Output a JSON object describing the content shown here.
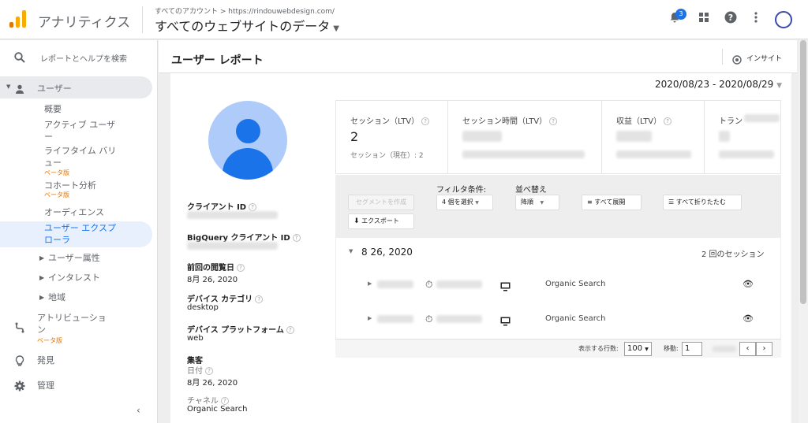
{
  "header": {
    "app_title": "アナリティクス",
    "breadcrumb": "すべてのアカウント > https://rindouwebdesign.com/",
    "property": "すべてのウェブサイトのデータ",
    "notification_count": "3"
  },
  "sidebar": {
    "search": "レポートとヘルプを検索",
    "users": "ユーザー",
    "items": [
      {
        "label": "概要"
      },
      {
        "label": "アクティブ ユーザー"
      },
      {
        "label": "ライフタイム バリュー",
        "beta": "ベータ版"
      },
      {
        "label": "コホート分析",
        "beta": "ベータ版"
      },
      {
        "label": "オーディエンス"
      },
      {
        "label": "ユーザー エクスプローラ"
      },
      {
        "label": "ユーザー属性"
      },
      {
        "label": "インタレスト"
      },
      {
        "label": "地域"
      }
    ],
    "attribution": "アトリビューション",
    "attribution_beta": "ベータ版",
    "discover": "発見",
    "admin": "管理"
  },
  "report": {
    "title": "ユーザー レポート",
    "insight": "インサイト",
    "date_range": "2020/08/23 - 2020/08/29"
  },
  "profile": {
    "client_id_label": "クライアント ID",
    "bigquery_label": "BigQuery クライアント ID",
    "last_seen_label": "前回の閲覧日",
    "last_seen": "8月 26, 2020",
    "device_category_label": "デバイス カテゴリ",
    "device_category": "desktop",
    "device_platform_label": "デバイス プラットフォーム",
    "device_platform": "web",
    "acquisition_label": "集客",
    "date_label": "日付",
    "date": "8月 26, 2020",
    "channel_label": "チャネル",
    "channel": "Organic Search"
  },
  "metrics": [
    {
      "label": "セッション（LTV）",
      "value": "2",
      "sub": "セッション（現在）: 2"
    },
    {
      "label": "セッション時間（LTV）"
    },
    {
      "label": "収益（LTV）"
    },
    {
      "label": "トラン"
    }
  ],
  "filters": {
    "segment_btn": "セグメントを作成",
    "export_btn": "エクスポート",
    "filter_label": "フィルタ条件:",
    "filter_select": "4 個を選択",
    "sort_label": "並べ替え",
    "sort_select": "降順",
    "expand_all": "すべて展開",
    "collapse_all": "すべて折りたたむ"
  },
  "sessions": {
    "day": "8 26, 2020",
    "day_count": "2 回のセッション",
    "rows": [
      {
        "source": "Organic Search"
      },
      {
        "source": "Organic Search"
      }
    ]
  },
  "pager": {
    "rows_label": "表示する行数:",
    "rows_value": "100",
    "goto_label": "移動:",
    "goto_value": "1"
  },
  "colors": {
    "accent": "#1a73e8",
    "beta": "#e37400",
    "selected_bg": "#e8f0fe"
  }
}
